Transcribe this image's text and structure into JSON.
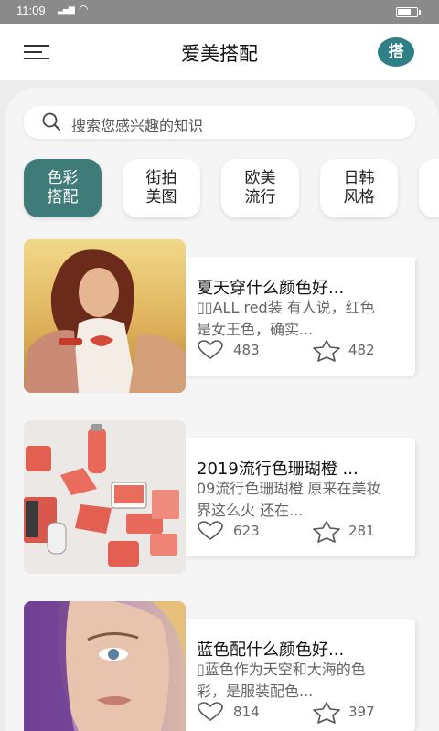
{
  "status_bar": {
    "time": "11:09",
    "signal": "4G",
    "wifi": "wifi"
  },
  "app_bar": {
    "title": "爱美搭配",
    "logo_char": "搭",
    "menu_icon": "menu-icon"
  },
  "search": {
    "placeholder": "搜索您感兴趣的知识"
  },
  "categories": [
    {
      "label": "色彩搭配",
      "active": true
    },
    {
      "label": "街拍美图",
      "active": false
    },
    {
      "label": "欧美流行",
      "active": false
    },
    {
      "label": "日韩风格",
      "active": false
    }
  ],
  "articles": [
    {
      "title": "夏天穿什么颜色好...",
      "desc": "▯▯ALL red装 有人说，红色是女王色，确实...",
      "likes": "483",
      "favorites": "482",
      "image": "woman-in-red-field-photo"
    },
    {
      "title": "2019流行色珊瑚橙 ...",
      "desc": "09流行色珊瑚橙 原来在美妆界这么火 还在...",
      "likes": "623",
      "favorites": "281",
      "image": "coral-products-photo"
    },
    {
      "title": "蓝色配什么颜色好...",
      "desc": "▯蓝色作为天空和大海的色彩，是服装配色...",
      "likes": "814",
      "favorites": "397",
      "image": "woman-face-makeup-photo"
    }
  ],
  "colors": {
    "accent": "#3f7b78",
    "logo": "#2e7f86",
    "status_bar": "#8a8a8a"
  }
}
